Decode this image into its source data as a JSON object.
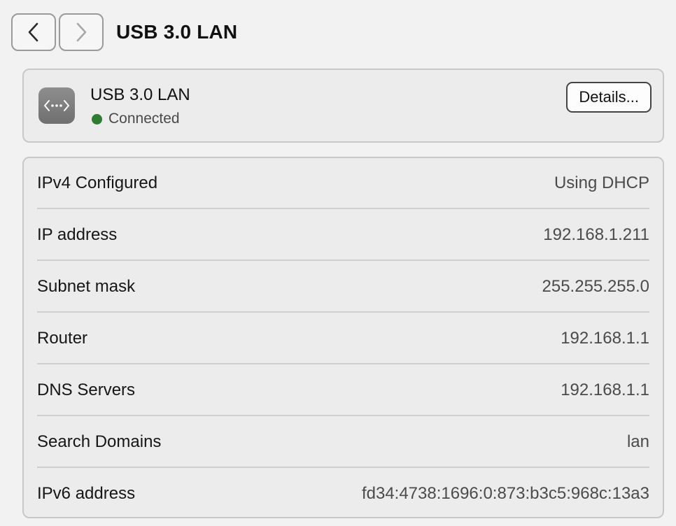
{
  "toolbar": {
    "title": "USB 3.0 LAN",
    "back_icon": "chevron-left-icon",
    "forward_icon": "chevron-right-icon"
  },
  "interface": {
    "name": "USB 3.0 LAN",
    "status": "Connected",
    "status_color": "#2e7d32",
    "icon": "network-dots-icon",
    "details_label": "Details..."
  },
  "info": {
    "rows": [
      {
        "label": "IPv4 Configured",
        "value": "Using DHCP"
      },
      {
        "label": "IP address",
        "value": "192.168.1.211"
      },
      {
        "label": "Subnet mask",
        "value": "255.255.255.0"
      },
      {
        "label": "Router",
        "value": "192.168.1.1"
      },
      {
        "label": "DNS Servers",
        "value": "192.168.1.1"
      },
      {
        "label": "Search Domains",
        "value": "lan"
      },
      {
        "label": "IPv6 address",
        "value": "fd34:4738:1696:0:873:b3c5:968c:13a3"
      }
    ]
  }
}
